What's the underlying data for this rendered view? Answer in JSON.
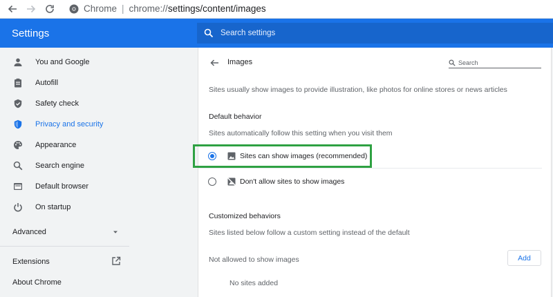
{
  "browser": {
    "site_label": "Chrome",
    "url_scheme": "chrome://",
    "url_path": "settings/content/images"
  },
  "header": {
    "title": "Settings",
    "search_placeholder": "Search settings"
  },
  "sidebar": {
    "items": [
      {
        "label": "You and Google",
        "icon": "person-icon"
      },
      {
        "label": "Autofill",
        "icon": "clipboard-icon"
      },
      {
        "label": "Safety check",
        "icon": "shield-check-icon"
      },
      {
        "label": "Privacy and security",
        "icon": "shield-icon",
        "active": true
      },
      {
        "label": "Appearance",
        "icon": "palette-icon"
      },
      {
        "label": "Search engine",
        "icon": "search-icon"
      },
      {
        "label": "Default browser",
        "icon": "browser-icon"
      },
      {
        "label": "On startup",
        "icon": "power-icon"
      }
    ],
    "advanced_label": "Advanced",
    "extensions_label": "Extensions",
    "about_label": "About Chrome"
  },
  "page": {
    "title": "Images",
    "search_placeholder": "Search",
    "description": "Sites usually show images to provide illustration, like photos for online stores or news articles",
    "default_behavior": {
      "heading": "Default behavior",
      "subtext": "Sites automatically follow this setting when you visit them",
      "options": [
        {
          "label": "Sites can show images (recommended)",
          "checked": true,
          "icon": "image-icon"
        },
        {
          "label": "Don't allow sites to show images",
          "checked": false,
          "icon": "image-off-icon"
        }
      ]
    },
    "customized": {
      "heading": "Customized behaviors",
      "subtext": "Sites listed below follow a custom setting instead of the default",
      "not_allowed_label": "Not allowed to show images",
      "add_button": "Add",
      "empty_text": "No sites added"
    }
  },
  "colors": {
    "accent": "#1a73e8",
    "highlight_box": "#2ea142"
  }
}
